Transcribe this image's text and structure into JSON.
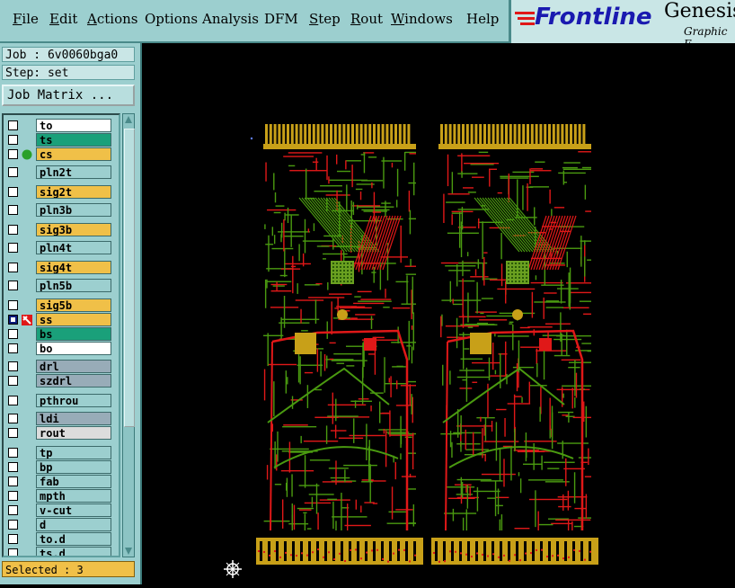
{
  "menubar": {
    "items": [
      {
        "label": "File",
        "underline": "F",
        "rest": "ile"
      },
      {
        "label": "Edit",
        "underline": "E",
        "rest": "dit"
      },
      {
        "label": "Actions",
        "underline": "A",
        "rest": "ctions"
      },
      {
        "label": "Options",
        "underline": "",
        "rest": "Options"
      },
      {
        "label": "Analysis",
        "underline": "",
        "rest": "Analysis"
      },
      {
        "label": "DFM",
        "underline": "",
        "rest": "DFM"
      },
      {
        "label": "Step",
        "underline": "S",
        "rest": "tep"
      },
      {
        "label": "Rout",
        "underline": "R",
        "rest": "out"
      },
      {
        "label": "Windows",
        "underline": "W",
        "rest": "indows"
      },
      {
        "label": "Help",
        "underline": "",
        "rest": "Help"
      }
    ]
  },
  "brand": {
    "logo": "Frontline",
    "product": "Genesis",
    "subtitle": "Graphic E"
  },
  "job": {
    "job_label": "Job : 6v0060bga0",
    "step_label": "Step: set",
    "matrix_button": "Job Matrix ..."
  },
  "layers": [
    {
      "name": "to",
      "color": "#ffffff",
      "checked": false
    },
    {
      "name": "ts",
      "color": "#1aa07a",
      "checked": false
    },
    {
      "name": "cs",
      "color": "#f0c048",
      "checked": false,
      "mark": "green-dot"
    },
    {
      "name": "pln2t",
      "color": "#9ccfcf",
      "checked": false
    },
    {
      "name": "sig2t",
      "color": "#f0c048",
      "checked": false
    },
    {
      "name": "pln3b",
      "color": "#9ccfcf",
      "checked": false
    },
    {
      "name": "sig3b",
      "color": "#f0c048",
      "checked": false
    },
    {
      "name": "pln4t",
      "color": "#9ccfcf",
      "checked": false
    },
    {
      "name": "sig4t",
      "color": "#f0c048",
      "checked": false
    },
    {
      "name": "pln5b",
      "color": "#9ccfcf",
      "checked": false
    },
    {
      "name": "sig5b",
      "color": "#f0c048",
      "checked": false
    },
    {
      "name": "ss",
      "color": "#f0c048",
      "checked": true,
      "mark": "red-tool"
    },
    {
      "name": "bs",
      "color": "#1aa07a",
      "checked": false
    },
    {
      "name": "bo",
      "color": "#ffffff",
      "checked": false
    },
    {
      "name": "drl",
      "color": "#98acb8",
      "checked": false
    },
    {
      "name": "szdrl",
      "color": "#98acb8",
      "checked": false
    },
    {
      "name": "pthrou",
      "color": "#9ccfcf",
      "checked": false
    },
    {
      "name": "ldi",
      "color": "#98acb8",
      "checked": false
    },
    {
      "name": "rout",
      "color": "#dcdcdc",
      "checked": false
    },
    {
      "name": "tp",
      "color": "#9ccfcf",
      "checked": false
    },
    {
      "name": "bp",
      "color": "#9ccfcf",
      "checked": false
    },
    {
      "name": "fab",
      "color": "#9ccfcf",
      "checked": false
    },
    {
      "name": "mpth",
      "color": "#9ccfcf",
      "checked": false
    },
    {
      "name": "v-cut",
      "color": "#9ccfcf",
      "checked": false
    },
    {
      "name": "d",
      "color": "#9ccfcf",
      "checked": false
    },
    {
      "name": "to.d",
      "color": "#9ccfcf",
      "checked": false
    },
    {
      "name": "ts.d",
      "color": "#9ccfcf",
      "checked": false
    }
  ],
  "status": {
    "selected": "Selected : 3"
  },
  "colors": {
    "trace_green": "#4a9a10",
    "trace_red": "#e01818",
    "pad_yellow": "#c8a018",
    "background": "#000000"
  }
}
